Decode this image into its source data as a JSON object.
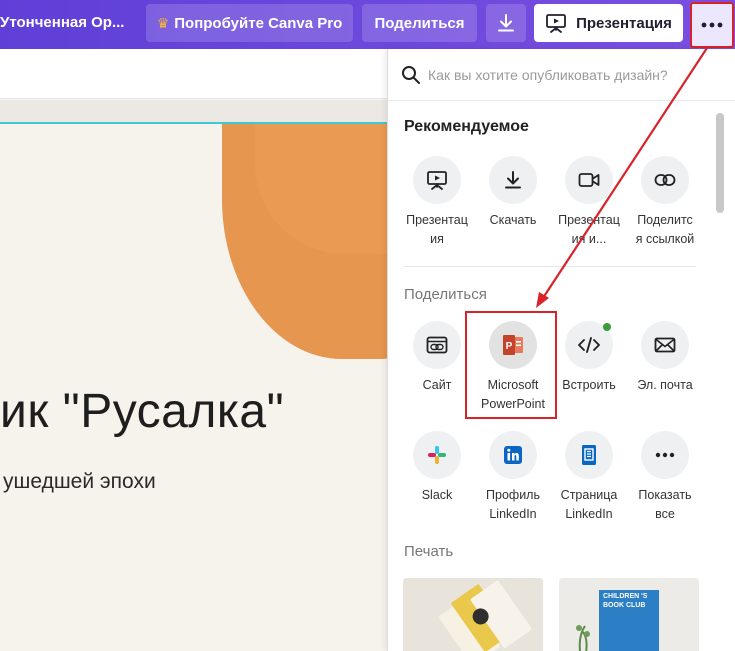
{
  "topbar": {
    "doc_title": "Утонченная Ор...",
    "pro_button": "Попробуйте Canva Pro",
    "share_button": "Поделиться",
    "present_button": "Презентация",
    "gradient_colors": [
      "#5f3fd7",
      "#7a4fe0"
    ]
  },
  "canvas": {
    "headline": "ик \"Русалка\"",
    "subline": "ушедшей эпохи",
    "accent_color": "#e6964e"
  },
  "panel": {
    "search_placeholder": "Как вы хотите опубликовать дизайн?",
    "recommended_title": "Рекомендуемое",
    "recommended": [
      {
        "label1": "Презентац",
        "label2": "ия",
        "icon": "presentation-icon"
      },
      {
        "label1": "Скачать",
        "label2": "",
        "icon": "download-icon"
      },
      {
        "label1": "Презентац",
        "label2": "ия и...",
        "icon": "video-camera-icon"
      },
      {
        "label1": "Поделитс",
        "label2": "я ссылкой",
        "icon": "link-icon"
      }
    ],
    "share_title": "Поделиться",
    "share": [
      {
        "label1": "Сайт",
        "label2": "",
        "icon": "website-icon"
      },
      {
        "label1": "Microsoft",
        "label2": "PowerPoint",
        "icon": "powerpoint-icon"
      },
      {
        "label1": "Встроить",
        "label2": "",
        "icon": "embed-icon"
      },
      {
        "label1": "Эл. почта",
        "label2": "",
        "icon": "email-icon"
      },
      {
        "label1": "Slack",
        "label2": "",
        "icon": "slack-icon"
      },
      {
        "label1": "Профиль",
        "label2": "LinkedIn",
        "icon": "linkedin-icon"
      },
      {
        "label1": "Страница",
        "label2": "LinkedIn",
        "icon": "linkedin-page-icon"
      },
      {
        "label1": "Показать",
        "label2": "все",
        "icon": "more-dots-icon"
      }
    ],
    "print_title": "Печать",
    "print_cards": [
      {
        "text1": "CHILDREN 'S",
        "text2": "BOOK CLUB"
      }
    ]
  },
  "annotation_color": "#d8232a"
}
